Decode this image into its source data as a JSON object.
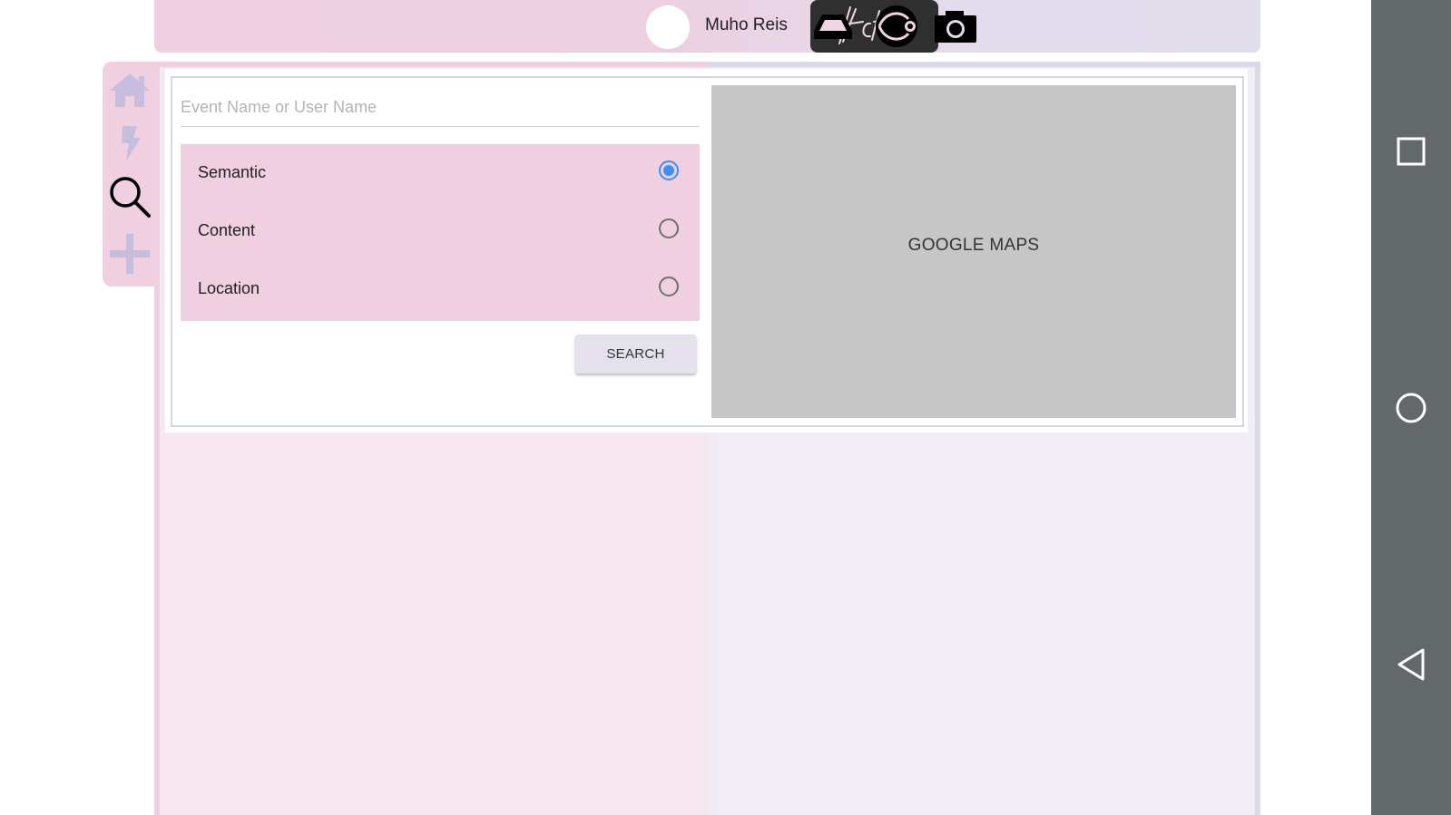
{
  "header": {
    "username": "Muho Reis",
    "logo_text": "Actoc",
    "icons": [
      "avatar-circle",
      "hat-icon",
      "eye-logo-icon",
      "camera-icon"
    ]
  },
  "sidebar": {
    "items": [
      {
        "icon": "home-icon",
        "active": false
      },
      {
        "icon": "lightning-icon",
        "active": false
      },
      {
        "icon": "search-icon",
        "active": true
      },
      {
        "icon": "plus-icon",
        "active": false
      }
    ]
  },
  "search": {
    "placeholder": "Event Name or User Name",
    "value": "",
    "options": [
      {
        "label": "Semantic",
        "selected": true
      },
      {
        "label": "Content",
        "selected": false
      },
      {
        "label": "Location",
        "selected": false
      }
    ],
    "button_label": "SEARCH"
  },
  "map": {
    "label": "GOOGLE MAPS"
  },
  "navbar": {
    "icons": [
      "recents-square-icon",
      "home-circle-icon",
      "back-triangle-icon"
    ]
  },
  "colors": {
    "pink": "#efcfe0",
    "lavender": "#dcd9e9",
    "radio_accent": "#3d8ff2",
    "map_grey": "#c6c6c6",
    "navbar": "#63686b"
  }
}
